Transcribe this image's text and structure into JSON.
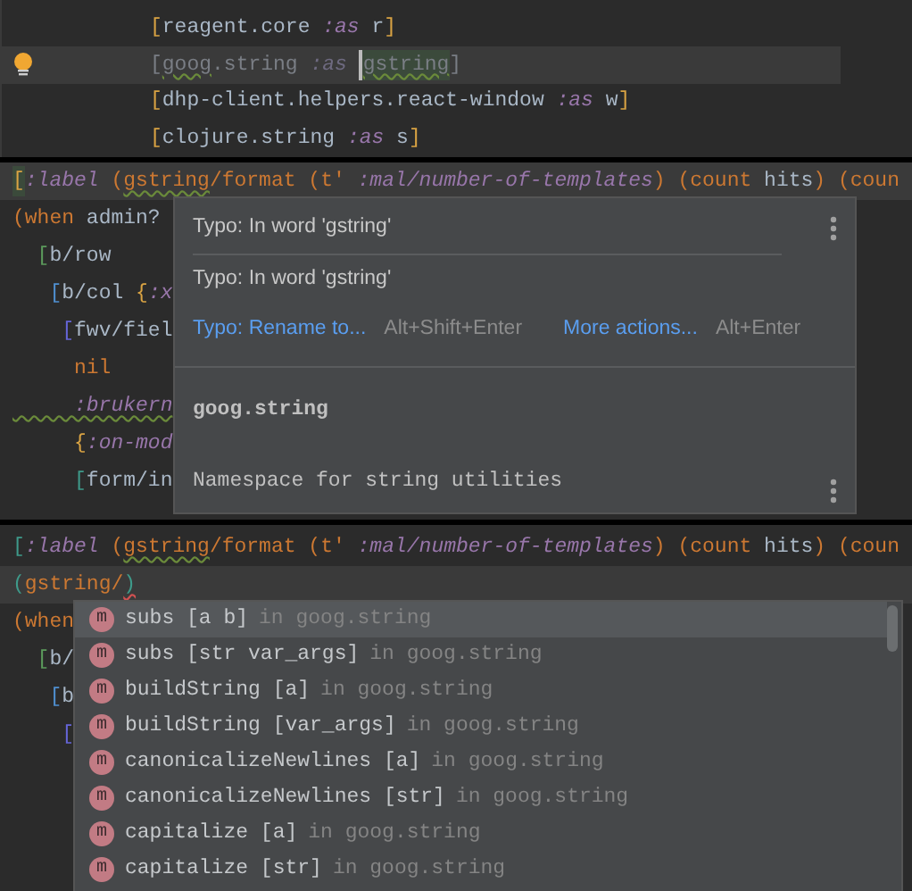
{
  "top_editor": {
    "lines": [
      {
        "caret_line": false,
        "intention_bulb": false,
        "tokens": [
          {
            "text": "[",
            "kind": "bracket",
            "color": "#d9a343"
          },
          {
            "text": "reagent.core ",
            "kind": "plain"
          },
          {
            "text": ":as",
            "kind": "keyword"
          },
          {
            "text": " r",
            "kind": "plain"
          },
          {
            "text": "]",
            "kind": "bracket",
            "color": "#d9a343"
          }
        ]
      },
      {
        "caret_line": true,
        "intention_bulb": true,
        "tokens": [
          {
            "text": "[",
            "kind": "dim"
          },
          {
            "text": "goog",
            "kind": "dim",
            "typo": true
          },
          {
            "text": ".string ",
            "kind": "dim"
          },
          {
            "text": ":as ",
            "kind": "dim-keyword"
          },
          {
            "text": "gstring",
            "kind": "dim",
            "typo": true,
            "highlight": true,
            "caret": true
          },
          {
            "text": "]",
            "kind": "dim"
          }
        ]
      },
      {
        "caret_line": false,
        "intention_bulb": false,
        "tokens": [
          {
            "text": "[",
            "kind": "bracket",
            "color": "#d9a343"
          },
          {
            "text": "dhp-client.helpers.react-window ",
            "kind": "plain"
          },
          {
            "text": ":as",
            "kind": "keyword"
          },
          {
            "text": " w",
            "kind": "plain"
          },
          {
            "text": "]",
            "kind": "bracket",
            "color": "#d9a343"
          }
        ]
      },
      {
        "caret_line": false,
        "intention_bulb": false,
        "tokens": [
          {
            "text": "[",
            "kind": "bracket",
            "color": "#d9a343"
          },
          {
            "text": "clojure.string ",
            "kind": "plain"
          },
          {
            "text": ":as",
            "kind": "keyword"
          },
          {
            "text": " s",
            "kind": "plain"
          },
          {
            "text": "]",
            "kind": "bracket",
            "color": "#d9a343"
          }
        ]
      }
    ]
  },
  "middle_editor": {
    "lines": [
      {
        "caret_line": true,
        "tokens": [
          {
            "text": "[",
            "kind": "bracket",
            "color": "#d9a343",
            "highlight": true
          },
          {
            "text": ":label",
            "kind": "keyword"
          },
          {
            "text": " (",
            "kind": "symbol"
          },
          {
            "text": "gstring",
            "kind": "symbol",
            "typo": true
          },
          {
            "text": "/format (t' ",
            "kind": "symbol"
          },
          {
            "text": ":mal/number-of-templates",
            "kind": "keyword"
          },
          {
            "text": ") (count ",
            "kind": "symbol"
          },
          {
            "text": "hits",
            "kind": "plain"
          },
          {
            "text": ") (coun",
            "kind": "symbol"
          }
        ]
      },
      {
        "caret_line": false,
        "tokens": [
          {
            "text": "(when ",
            "kind": "symbol"
          },
          {
            "text": "admin?",
            "kind": "plain"
          }
        ]
      },
      {
        "caret_line": false,
        "tokens": [
          {
            "text": "  [",
            "kind": "bracket",
            "color": "#5b9a5b"
          },
          {
            "text": "b/row",
            "kind": "plain"
          }
        ]
      },
      {
        "caret_line": false,
        "tokens": [
          {
            "text": "   [",
            "kind": "bracket",
            "color": "#4f8fd0"
          },
          {
            "text": "b/col ",
            "kind": "plain"
          },
          {
            "text": "{",
            "kind": "bracket",
            "color": "#d9a343"
          },
          {
            "text": ":x",
            "kind": "keyword"
          }
        ]
      },
      {
        "caret_line": false,
        "tokens": [
          {
            "text": "    [",
            "kind": "bracket",
            "color": "#6565d8"
          },
          {
            "text": "fwv/fiel",
            "kind": "plain"
          }
        ]
      },
      {
        "caret_line": false,
        "tokens": [
          {
            "text": "     nil",
            "kind": "symbol"
          }
        ]
      },
      {
        "caret_line": false,
        "tokens": [
          {
            "text": "     :brukern",
            "kind": "keyword",
            "typo": true
          }
        ]
      },
      {
        "caret_line": false,
        "tokens": [
          {
            "text": "     {",
            "kind": "bracket",
            "color": "#d9a343"
          },
          {
            "text": ":on-mod",
            "kind": "keyword"
          }
        ]
      },
      {
        "caret_line": false,
        "tokens": [
          {
            "text": "     [",
            "kind": "bracket",
            "color": "#3e9a8a"
          },
          {
            "text": "form/in",
            "kind": "plain"
          }
        ]
      }
    ],
    "popup": {
      "problems": [
        "Typo: In word 'gstring'",
        "Typo: In word 'gstring'"
      ],
      "actions": [
        {
          "label": "Typo: Rename to...",
          "shortcut": "Alt+Shift+Enter"
        },
        {
          "label": "More actions...",
          "shortcut": "Alt+Enter"
        }
      ],
      "doc_title": "goog.string",
      "doc_text": "Namespace for string utilities"
    }
  },
  "bottom_editor": {
    "lines": [
      {
        "caret_line": false,
        "tokens": [
          {
            "text": "[",
            "kind": "bracket",
            "color": "#3e9a8a"
          },
          {
            "text": ":label",
            "kind": "keyword"
          },
          {
            "text": " (",
            "kind": "symbol"
          },
          {
            "text": "gstring",
            "kind": "symbol",
            "typo": true
          },
          {
            "text": "/format (t' ",
            "kind": "symbol"
          },
          {
            "text": ":mal/number-of-templates",
            "kind": "keyword"
          },
          {
            "text": ") (count ",
            "kind": "symbol"
          },
          {
            "text": "hits",
            "kind": "plain"
          },
          {
            "text": ") (coun",
            "kind": "symbol"
          }
        ]
      },
      {
        "caret_line": true,
        "tokens": [
          {
            "text": "(",
            "kind": "bracket",
            "color": "#3e9a8a"
          },
          {
            "text": "gstring/",
            "kind": "symbol"
          },
          {
            "text": ")",
            "kind": "bracket",
            "color": "#3e9a8a",
            "error": true
          }
        ]
      },
      {
        "caret_line": false,
        "tokens": [
          {
            "text": "(when",
            "kind": "symbol"
          }
        ]
      },
      {
        "caret_line": false,
        "tokens": [
          {
            "text": "  [",
            "kind": "bracket",
            "color": "#5b9a5b"
          },
          {
            "text": "b/",
            "kind": "plain"
          }
        ]
      },
      {
        "caret_line": false,
        "tokens": [
          {
            "text": "   [",
            "kind": "bracket",
            "color": "#4f8fd0"
          },
          {
            "text": "b",
            "kind": "plain"
          }
        ]
      },
      {
        "caret_line": false,
        "tokens": [
          {
            "text": "    [",
            "kind": "bracket",
            "color": "#6565d8"
          }
        ]
      }
    ],
    "completion": {
      "items": [
        {
          "icon": "m",
          "name": "subs",
          "args": "[a b]",
          "location": "in goog.string",
          "selected": true
        },
        {
          "icon": "m",
          "name": "subs",
          "args": "[str var_args]",
          "location": "in goog.string",
          "selected": false
        },
        {
          "icon": "m",
          "name": "buildString",
          "args": "[a]",
          "location": "in goog.string",
          "selected": false
        },
        {
          "icon": "m",
          "name": "buildString",
          "args": "[var_args]",
          "location": "in goog.string",
          "selected": false
        },
        {
          "icon": "m",
          "name": "canonicalizeNewlines",
          "args": "[a]",
          "location": "in goog.string",
          "selected": false
        },
        {
          "icon": "m",
          "name": "canonicalizeNewlines",
          "args": "[str]",
          "location": "in goog.string",
          "selected": false
        },
        {
          "icon": "m",
          "name": "capitalize",
          "args": "[a]",
          "location": "in goog.string",
          "selected": false
        },
        {
          "icon": "m",
          "name": "capitalize",
          "args": "[str]",
          "location": "in goog.string",
          "selected": false
        }
      ]
    }
  }
}
